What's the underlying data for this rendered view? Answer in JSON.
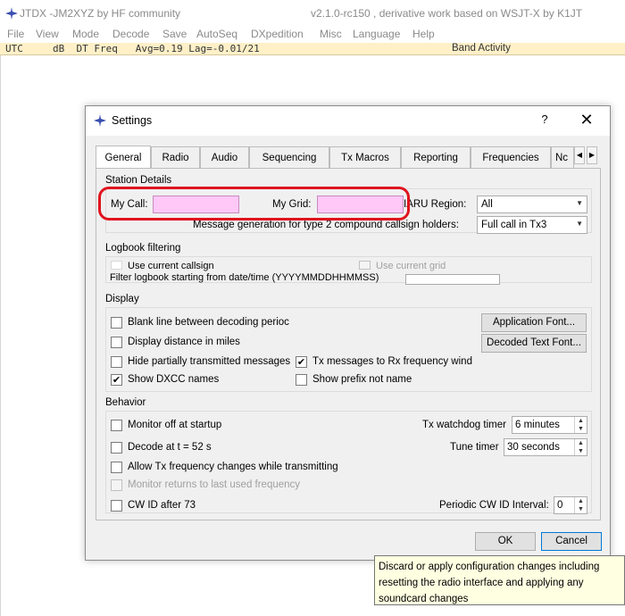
{
  "window": {
    "title": "JTDX -JM2XYZ by HF community",
    "version": "v2.1.0-rc150 , derivative work based on WSJT-X by K1JT"
  },
  "menu": [
    "File",
    "View",
    "Mode",
    "Decode",
    "Save",
    "AutoSeq",
    "DXpedition",
    "Misc",
    "Language",
    "Help"
  ],
  "header": {
    "columns": "UTC     dB  DT Freq   Avg=0.19 Lag=-0.01/21",
    "band_activity": "Band Activity"
  },
  "dialog": {
    "title": "Settings",
    "help": "?",
    "close": "✕",
    "tabs": [
      "General",
      "Radio",
      "Audio",
      "Sequencing",
      "Tx Macros",
      "Reporting",
      "Frequencies",
      "Nс"
    ],
    "active_tab": "General",
    "station": {
      "heading": "Station Details",
      "my_call_label": "My Call:",
      "my_call_value": "",
      "my_grid_label": "My Grid:",
      "my_grid_value": "",
      "iaru_label": "IARU Region:",
      "iaru_value": "All",
      "msg_gen_label": "Message generation for type 2 compound callsign holders:",
      "msg_gen_value": "Full call in Tx3"
    },
    "logbook": {
      "heading": "Logbook filtering",
      "use_current_callsign": "Use current callsign",
      "use_current_grid": "Use current grid",
      "filter_label": "Filter logbook starting from date/time (YYYYMMDDHHMMSS)"
    },
    "display": {
      "heading": "Display",
      "blank_line": "Blank line between decoding perioc",
      "distance_miles": "Display distance in miles",
      "hide_partial": "Hide partially transmitted messages",
      "tx_messages": "Tx messages to Rx frequency wind",
      "show_dxcc": "Show DXCC names",
      "show_prefix": "Show prefix not name",
      "app_font_btn": "Application Font...",
      "decoded_font_btn": "Decoded Text Font..."
    },
    "behavior": {
      "heading": "Behavior",
      "monitor_off": "Monitor off at startup",
      "decode_at": "Decode at t = 52 s",
      "allow_tx_freq": "Allow Tx frequency changes while transmitting",
      "monitor_returns": "Monitor returns to last used frequency",
      "cw_id": "CW ID after 73",
      "tx_watchdog_label": "Tx watchdog timer",
      "tx_watchdog_value": "6 minutes",
      "tune_timer_label": "Tune timer",
      "tune_timer_value": "30 seconds",
      "cw_interval_label": "Periodic CW ID Interval:",
      "cw_interval_value": "0"
    },
    "ok": "OK",
    "cancel": "Cancel"
  },
  "tooltip": {
    "line1": "Discard or apply configuration changes including",
    "line2": "resetting the radio interface and applying any",
    "line3": "soundcard changes"
  },
  "colors": {
    "field_highlight": "#ffc8f7",
    "annotation_red": "#e0141e",
    "header_strip": "#fff0c8",
    "tooltip_bg": "#ffffe1"
  }
}
